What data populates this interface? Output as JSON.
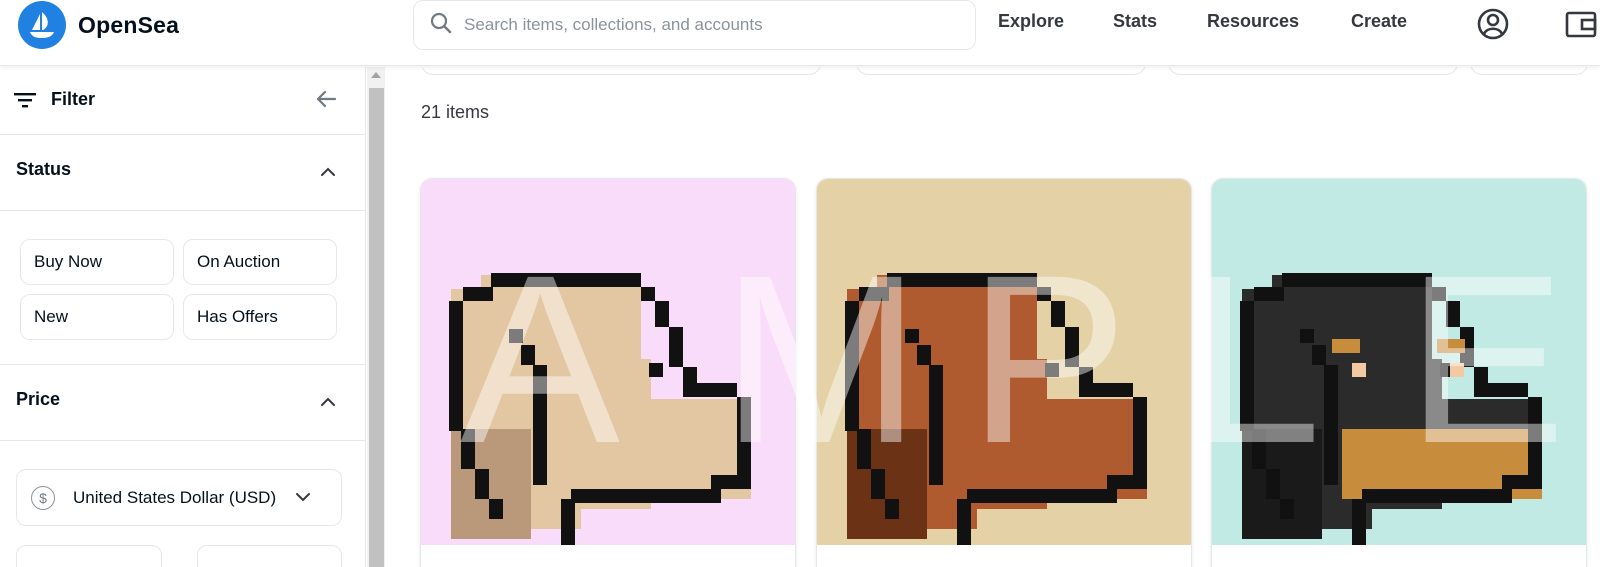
{
  "header": {
    "brand": "OpenSea",
    "search_placeholder": "Search items, collections, and accounts",
    "nav": [
      "Explore",
      "Stats",
      "Resources",
      "Create"
    ],
    "icons": [
      "profile-icon",
      "wallet-icon"
    ]
  },
  "sidebar": {
    "filter_label": "Filter",
    "status": {
      "title": "Status",
      "options": [
        "Buy Now",
        "On Auction",
        "New",
        "Has Offers"
      ]
    },
    "price": {
      "title": "Price",
      "currency": "United States Dollar (USD)"
    }
  },
  "main": {
    "item_count": "21 items",
    "watermark_letters": [
      "A",
      "M",
      "P",
      "L",
      "E"
    ],
    "cards": [
      {
        "bg": "#f9dcf9",
        "fur": "#e3c6a2",
        "ear": "#b9997a",
        "name": "dog-light"
      },
      {
        "bg": "#e4d2a6",
        "fur": "#b05a2f",
        "ear": "#6b3216",
        "name": "dog-red"
      },
      {
        "bg": "#c0eae3",
        "fur": "#2b2b2b",
        "ear": "#1a1a1a",
        "muzzle": "#c78d3d",
        "name": "dog-black"
      }
    ]
  }
}
